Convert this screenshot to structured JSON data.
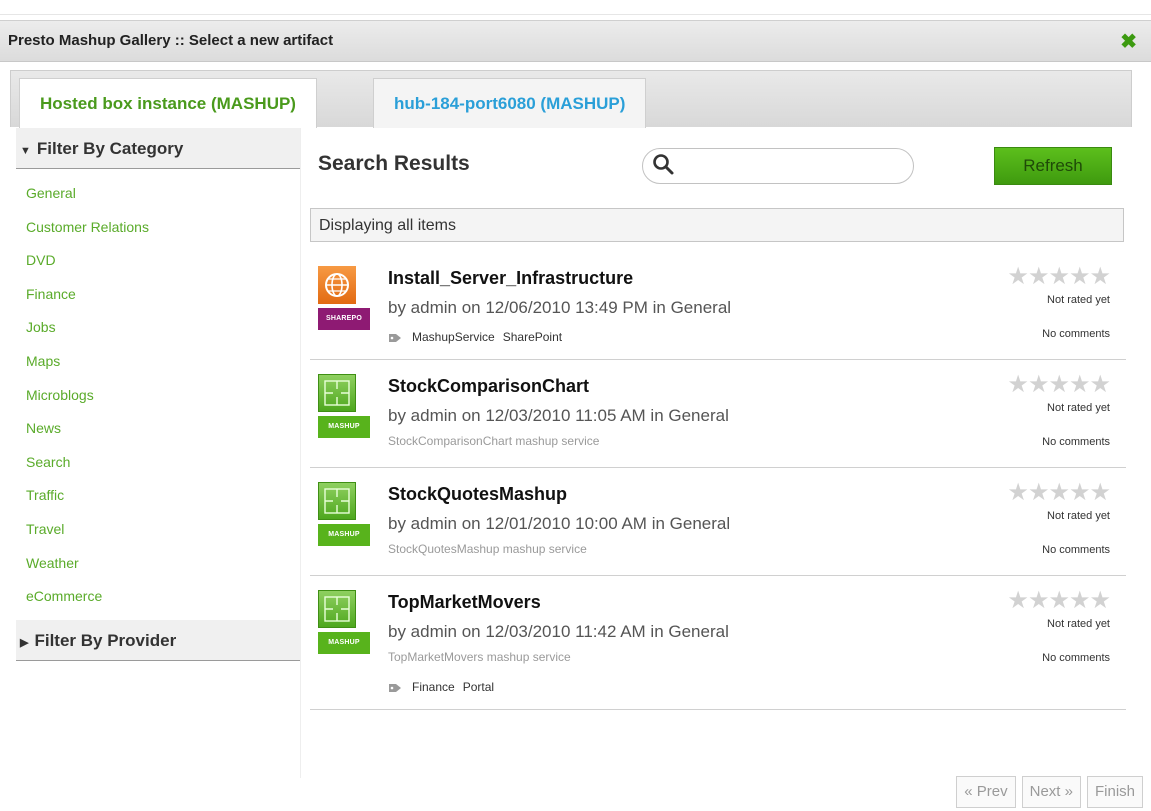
{
  "dialog": {
    "title": "Presto Mashup Gallery :: Select a new artifact",
    "close_glyph": "✖"
  },
  "tabs": [
    {
      "label": "Hosted box instance (MASHUP)",
      "active": true
    },
    {
      "label": "hub-184-port6080 (MASHUP)",
      "active": false
    }
  ],
  "sidebar": {
    "category_header": "Filter By Category",
    "categories": [
      "General",
      "Customer Relations",
      "DVD",
      "Finance",
      "Jobs",
      "Maps",
      "Microblogs",
      "News",
      "Search",
      "Traffic",
      "Travel",
      "Weather",
      "eCommerce"
    ],
    "provider_header": "Filter By Provider"
  },
  "main": {
    "results_title": "Search Results",
    "search": {
      "placeholder": "",
      "value": ""
    },
    "refresh_label": "Refresh",
    "displaying": "Displaying all items"
  },
  "items": [
    {
      "title": "Install_Server_Infrastructure",
      "meta": "by admin  on  12/06/2010 13:49 PM  in General",
      "badge": "SHAREPO",
      "tags": [
        "MashupService",
        "SharePoint"
      ],
      "stars": "★★★★★",
      "rating": "Not rated yet",
      "comments": "No comments"
    },
    {
      "title": "StockComparisonChart",
      "meta": "by admin  on  12/03/2010 11:05 AM  in General",
      "badge": "MASHUP",
      "description": "StockComparisonChart mashup service",
      "stars": "★★★★★",
      "rating": "Not rated yet",
      "comments": "No comments"
    },
    {
      "title": "StockQuotesMashup",
      "meta": "by admin  on  12/01/2010 10:00 AM  in General",
      "badge": "MASHUP",
      "description": "StockQuotesMashup mashup service",
      "stars": "★★★★★",
      "rating": "Not rated yet",
      "comments": "No comments"
    },
    {
      "title": "TopMarketMovers",
      "meta": "by admin  on  12/03/2010 11:42 AM  in General",
      "badge": "MASHUP",
      "description": "TopMarketMovers mashup service",
      "tags": [
        "Finance",
        "Portal"
      ],
      "stars": "★★★★★",
      "rating": "Not rated yet",
      "comments": "No comments"
    }
  ],
  "pager": {
    "prev": "« Prev",
    "next": "Next »",
    "finish": "Finish"
  },
  "colors": {
    "accent_green": "#5aab2a",
    "tab_blue": "#2a9fd8",
    "badge_purple": "#8e1a73"
  }
}
